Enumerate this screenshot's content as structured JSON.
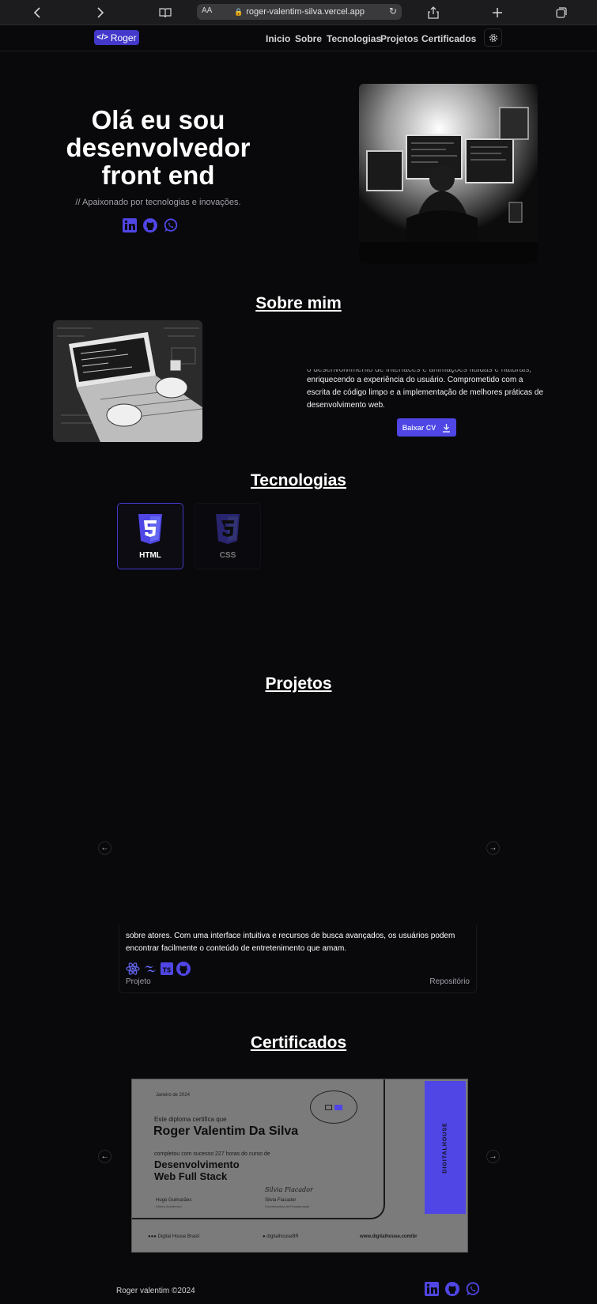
{
  "browser": {
    "url": "roger-valentim-silva.vercel.app",
    "text_size_label": "AA"
  },
  "nav": {
    "logo_label": "Roger",
    "links": [
      "Inicio",
      "Sobre",
      "Tecnologias",
      "Projetos",
      "Certificados"
    ]
  },
  "hero": {
    "title": "Olá eu sou desenvolvedor front end",
    "subtitle": "// Apaixonado por tecnologias e inovações."
  },
  "about": {
    "title": "Sobre mim",
    "text_cut": "o desenvolvimento de interfaces e animações fluidas e naturais,",
    "text": "enriquecendo a experiência do usuário. Comprometido com a escrita de código limpo e a implementação de melhores práticas de desenvolvimento web.",
    "cv_button": "Baixar CV"
  },
  "technologies": {
    "title": "Tecnologias",
    "items": [
      {
        "label": "HTML",
        "icon": "html5-icon",
        "color": "#4f46e5"
      },
      {
        "label": "CSS",
        "icon": "css3-icon",
        "color": "#4f46e5"
      }
    ]
  },
  "projects": {
    "title": "Projetos",
    "description": "sobre atores. Com uma interface intuitiva e recursos de busca avançados, os usuários podem encontrar facilmente o conteúdo de entretenimento que amam.",
    "project_link": "Projeto",
    "repo_link": "Repositório",
    "stack_icons": [
      "react-icon",
      "tailwind-icon",
      "typescript-icon",
      "github-icon"
    ]
  },
  "certificates": {
    "title": "Certificados",
    "date": "Janeiro de 2024",
    "intro": "Este diploma certifica que",
    "name": "Roger Valentim Da Silva",
    "completion": "completou com sucesso 227 horas do curso de",
    "course_line1": "Desenvolvimento",
    "course_line2": "Web Full Stack",
    "sign_script": "Silvia Fiacador",
    "sign1_name": "Hugo Guimarães",
    "sign1_role": "Diretor Acadêmico",
    "sign2_name": "Silvia Fiacador",
    "sign2_role": "Coordenadora de Programação",
    "brand": "DIGITALHOUSE",
    "footer_left": "Digital House Brasil",
    "footer_mid": "digitalhouseBR",
    "footer_right": "www.digitalhouse.com/br"
  },
  "footer": {
    "copyright": "Roger valentim ©2024"
  },
  "colors": {
    "accent": "#4f46e5",
    "background": "#09090b"
  }
}
